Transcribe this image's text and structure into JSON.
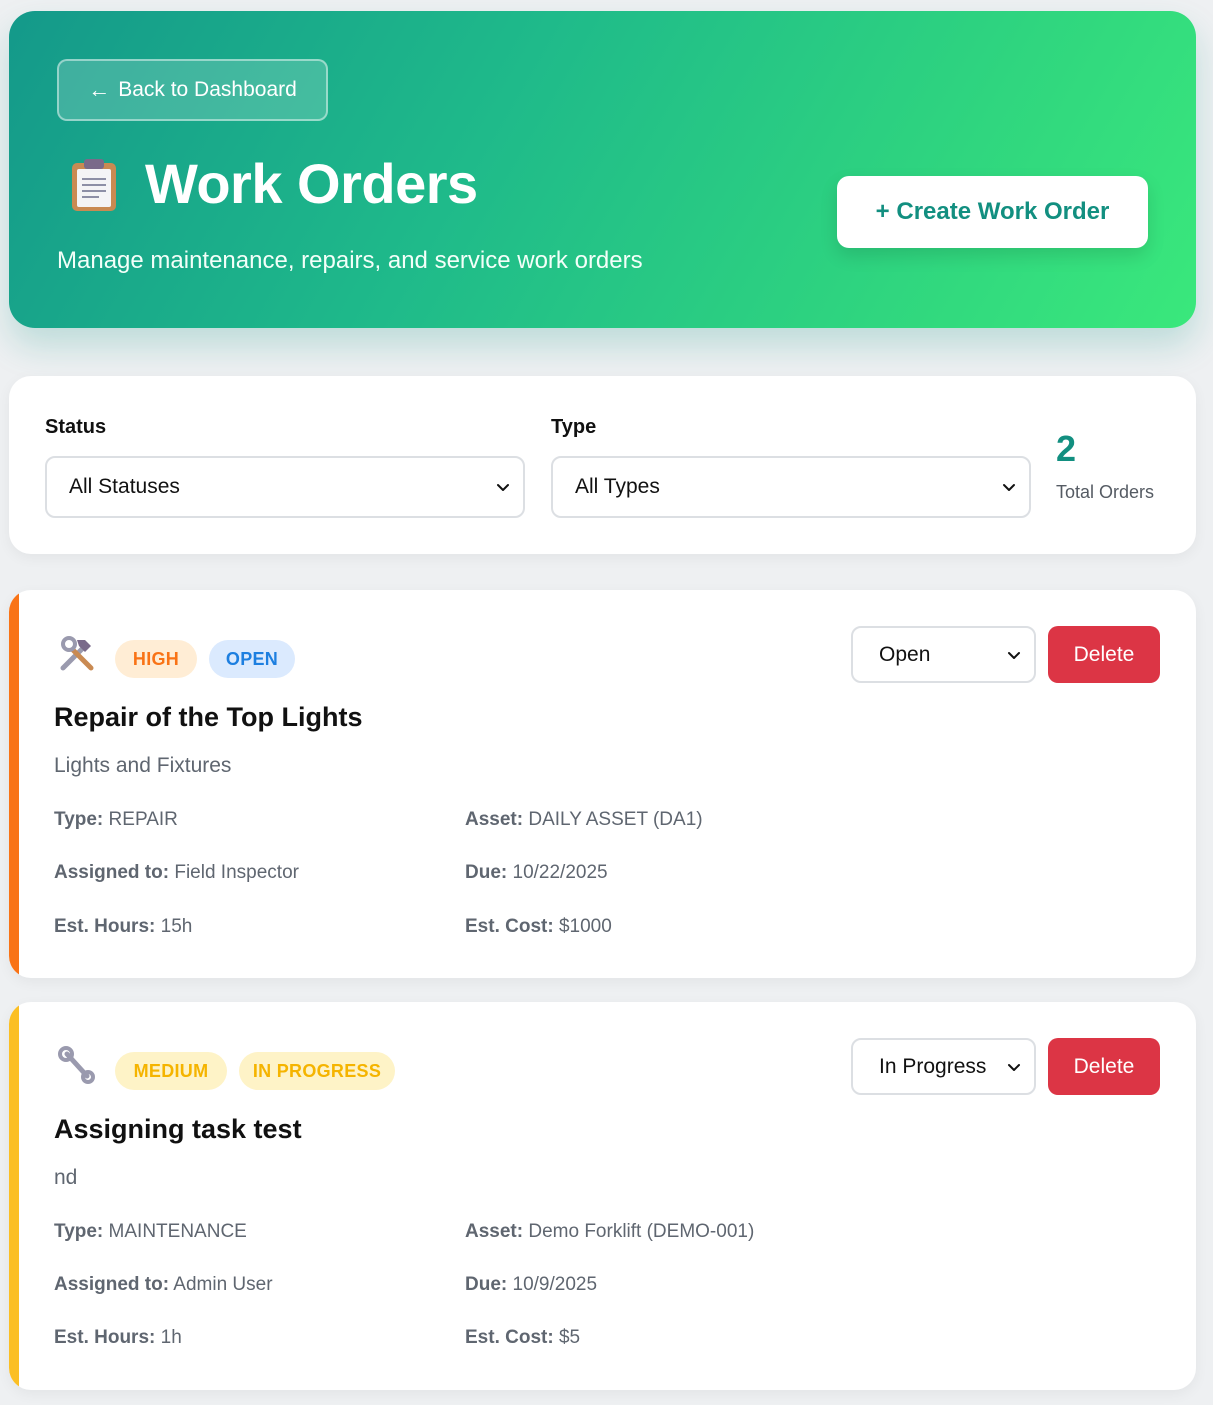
{
  "header": {
    "back_arrow": "←",
    "back_label": "Back to Dashboard",
    "title": "Work Orders",
    "subtitle": "Manage maintenance, repairs, and service work orders",
    "create_label": "+ Create Work Order",
    "title_icon": "clipboard-icon"
  },
  "filters": {
    "status_label": "Status",
    "status_value": "All Statuses",
    "type_label": "Type",
    "type_value": "All Types",
    "total_count": "2",
    "total_label": "Total Orders"
  },
  "colors": {
    "accent": "#128f80",
    "high": "#f97316",
    "medium": "#fbbf24",
    "delete": "#dc3545",
    "open_badge_bg": "#dbeafe",
    "open_badge_fg": "#1d7fe0"
  },
  "orders": [
    {
      "icon": "tools-icon",
      "priority": "HIGH",
      "status": "OPEN",
      "status_select": "Open",
      "delete_label": "Delete",
      "title": "Repair of the Top Lights",
      "description": "Lights and Fixtures",
      "type_label": "Type:",
      "type": "REPAIR",
      "asset_label": "Asset:",
      "asset": "DAILY ASSET (DA1)",
      "assigned_label": "Assigned to:",
      "assigned": "Field Inspector",
      "due_label": "Due:",
      "due": "10/22/2025",
      "hours_label": "Est. Hours:",
      "hours": "15h",
      "cost_label": "Est. Cost:",
      "cost": "$1000"
    },
    {
      "icon": "wrench-icon",
      "priority": "MEDIUM",
      "status": "IN PROGRESS",
      "status_select": "In Progress",
      "delete_label": "Delete",
      "title": "Assigning task test",
      "description": "nd",
      "type_label": "Type:",
      "type": "MAINTENANCE",
      "asset_label": "Asset:",
      "asset": "Demo Forklift (DEMO-001)",
      "assigned_label": "Assigned to:",
      "assigned": "Admin User",
      "due_label": "Due:",
      "due": "10/9/2025",
      "hours_label": "Est. Hours:",
      "hours": "1h",
      "cost_label": "Est. Cost:",
      "cost": "$5"
    }
  ]
}
